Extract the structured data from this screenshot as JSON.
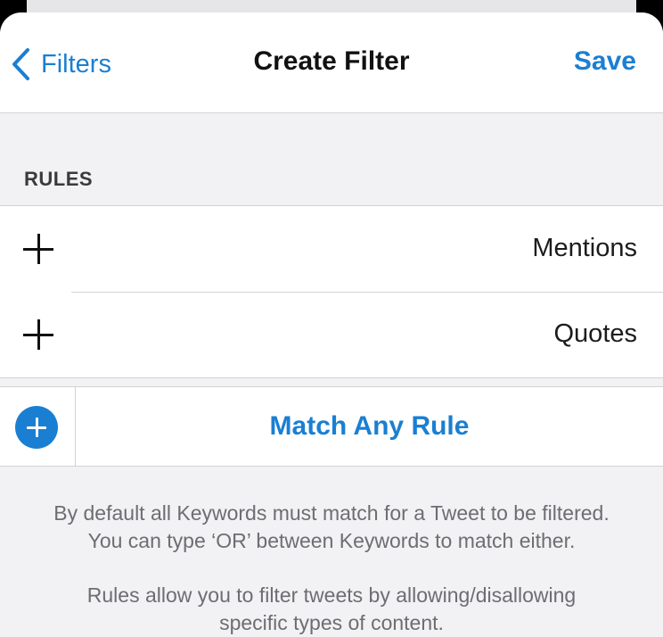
{
  "navbar": {
    "back_label": "Filters",
    "title": "Create Filter",
    "save_label": "Save"
  },
  "rules": {
    "header": "RULES",
    "items": [
      {
        "label": "Mentions",
        "icon": "plus-icon"
      },
      {
        "label": "Quotes",
        "icon": "plus-icon"
      }
    ]
  },
  "match": {
    "label": "Match Any Rule",
    "icon": "circle-plus-icon"
  },
  "footer": {
    "line1": "By default all Keywords must match for a Tweet to be filtered.",
    "line2": "You can type ‘OR’ between Keywords to match either.",
    "line3": "Rules allow you to filter tweets by allowing/disallowing",
    "line4": "specific types of content."
  },
  "colors": {
    "accent": "#1a7fd2",
    "background": "#f2f2f4",
    "separator": "#d3d3d6",
    "footer_text": "#6d6d72"
  }
}
